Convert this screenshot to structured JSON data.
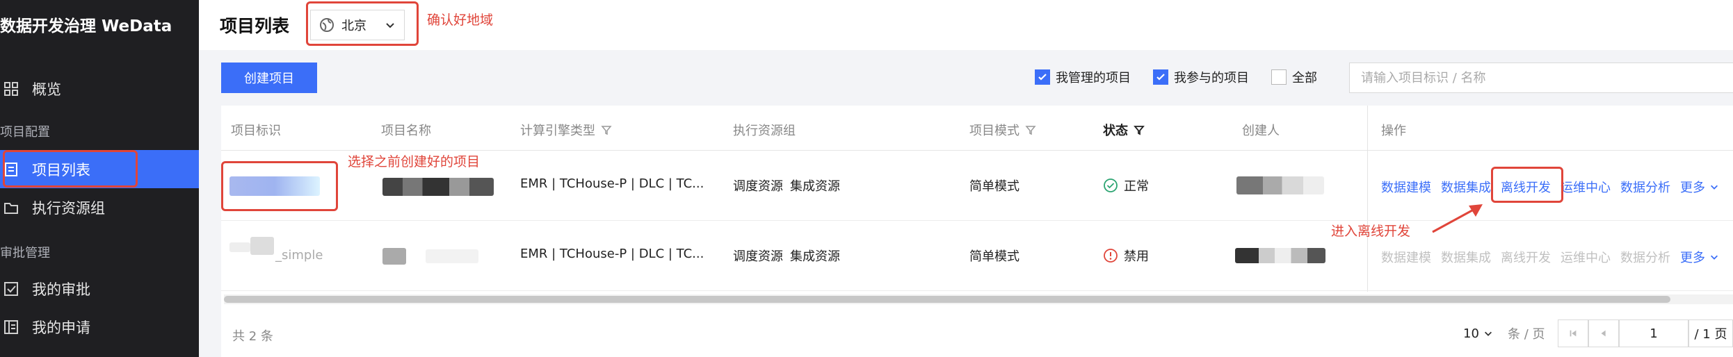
{
  "sidebar": {
    "app_title": "数据开发治理 WeData",
    "items": [
      {
        "label": "概览"
      },
      {
        "label": "项目列表"
      },
      {
        "label": "执行资源组"
      },
      {
        "label": "我的审批"
      },
      {
        "label": "我的申请"
      }
    ],
    "sections": [
      "项目配置",
      "审批管理"
    ]
  },
  "header": {
    "title": "项目列表",
    "region": "北京"
  },
  "annotations": {
    "region_note": "确认好地域",
    "project_note": "选择之前创建好的项目",
    "offline_note": "进入离线开发"
  },
  "toolbar": {
    "create_label": "创建项目",
    "filters": [
      {
        "label": "我管理的项目",
        "checked": true
      },
      {
        "label": "我参与的项目",
        "checked": true
      },
      {
        "label": "全部",
        "checked": false
      }
    ],
    "search_placeholder": "请输入项目标识 / 名称"
  },
  "table": {
    "columns": [
      "项目标识",
      "项目名称",
      "计算引擎类型",
      "执行资源组",
      "项目模式",
      "状态",
      "创建人",
      "操作"
    ],
    "rows": [
      {
        "engine": "EMR | TCHouse-P | DLC | TC...",
        "resources": [
          "调度资源",
          "集成资源"
        ],
        "mode": "简单模式",
        "status": "正常",
        "actions": [
          "数据建模",
          "数据集成",
          "离线开发",
          "运维中心",
          "数据分析",
          "更多"
        ]
      },
      {
        "id_fragment": "_simple",
        "engine": "EMR | TCHouse-P | DLC | TC...",
        "resources": [
          "调度资源",
          "集成资源"
        ],
        "mode": "简单模式",
        "status": "禁用",
        "actions": [
          "数据建模",
          "数据集成",
          "离线开发",
          "运维中心",
          "数据分析",
          "更多"
        ]
      }
    ]
  },
  "pagination": {
    "total": "共 2 条",
    "page_size": "10",
    "per_page_unit": "条 / 页",
    "current_page": "1",
    "total_pages": "/ 1 页"
  },
  "colors": {
    "accent": "#3b6ef8",
    "annotation": "#e0453a",
    "sidebar_bg": "#1f1f22",
    "ok": "#2ba471"
  }
}
